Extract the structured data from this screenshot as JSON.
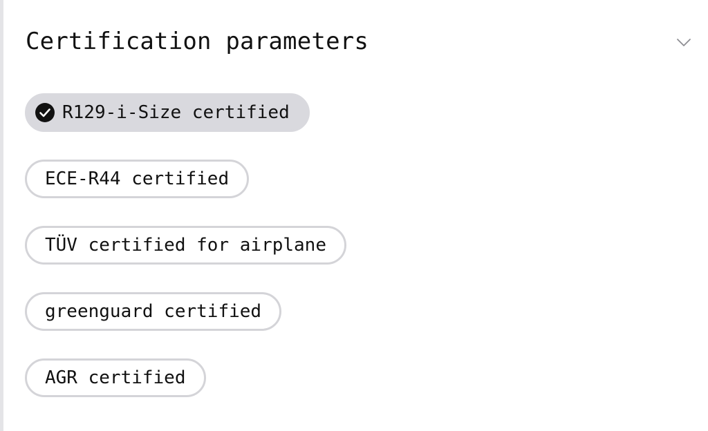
{
  "section": {
    "title": "Certification parameters",
    "expanded": true
  },
  "chips": [
    {
      "label": "R129-i-Size certified",
      "selected": true
    },
    {
      "label": "ECE-R44 certified",
      "selected": false
    },
    {
      "label": "TÜV certified for airplane",
      "selected": false
    },
    {
      "label": "greenguard certified",
      "selected": false
    },
    {
      "label": "AGR certified",
      "selected": false
    }
  ],
  "icons": {
    "toggle": "chevron-down-icon",
    "selected_marker": "check-circle-icon"
  },
  "colors": {
    "text": "#111111",
    "chip_border": "#d4d4d8",
    "chip_selected_bg": "#d9d9de",
    "check_fill": "#111111",
    "left_rule": "#e4e4e7"
  }
}
